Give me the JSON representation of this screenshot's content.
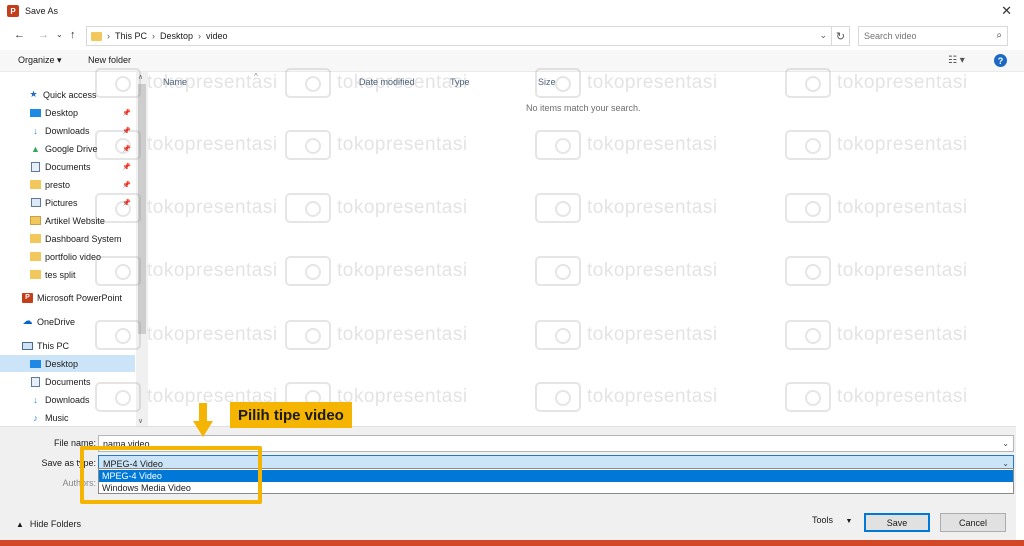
{
  "window": {
    "title": "Save As",
    "app_icon": "powerpoint-icon",
    "close_label": "✕"
  },
  "nav": {
    "back_label": "←",
    "forward_label": "→",
    "recent_label": "⌄",
    "up_label": "↑",
    "breadcrumbs": [
      "This PC",
      "Desktop",
      "video"
    ],
    "search_placeholder": "Search video"
  },
  "toolbar": {
    "organize_label": "Organize ▾",
    "new_folder_label": "New folder"
  },
  "sidebar": {
    "items": [
      {
        "label": "Quick access",
        "icon": "star-icon",
        "pinned": false
      },
      {
        "label": "Desktop",
        "icon": "desktop-icon",
        "pinned": true
      },
      {
        "label": "Downloads",
        "icon": "download-icon",
        "pinned": true
      },
      {
        "label": "Google Drive",
        "icon": "google-drive-icon",
        "pinned": true
      },
      {
        "label": "Documents",
        "icon": "documents-icon",
        "pinned": true
      },
      {
        "label": "presto",
        "icon": "folder-icon",
        "pinned": true
      },
      {
        "label": "Pictures",
        "icon": "pictures-icon",
        "pinned": true
      },
      {
        "label": "Artikel Website",
        "icon": "user-folder-icon",
        "pinned": false
      },
      {
        "label": "Dashboard System",
        "icon": "folder-icon",
        "pinned": false
      },
      {
        "label": "portfolio video",
        "icon": "folder-icon",
        "pinned": false
      },
      {
        "label": "tes split",
        "icon": "folder-icon",
        "pinned": false
      },
      {
        "label": "Microsoft PowerPoint",
        "icon": "powerpoint-icon",
        "pinned": false
      },
      {
        "label": "OneDrive",
        "icon": "onedrive-icon",
        "pinned": false
      },
      {
        "label": "This PC",
        "icon": "computer-icon",
        "pinned": false
      },
      {
        "label": "Desktop",
        "icon": "desktop-icon",
        "pinned": false
      },
      {
        "label": "Documents",
        "icon": "documents-icon",
        "pinned": false
      },
      {
        "label": "Downloads",
        "icon": "download-icon",
        "pinned": false
      },
      {
        "label": "Music",
        "icon": "music-icon",
        "pinned": false
      }
    ]
  },
  "filelist": {
    "columns": [
      "Name",
      "Date modified",
      "Type",
      "Size"
    ],
    "empty_message": "No items match your search."
  },
  "watermark": {
    "text": "tokopresentasi"
  },
  "form": {
    "file_name_label": "File name:",
    "file_name_value": "nama video",
    "save_as_type_label": "Save as type:",
    "save_as_type_value": "MPEG-4 Video",
    "authors_label": "Authors:",
    "type_options": [
      "MPEG-4 Video",
      "Windows Media Video"
    ]
  },
  "footer": {
    "hide_folders_label": "Hide Folders",
    "tools_label": "Tools",
    "save_label": "Save",
    "cancel_label": "Cancel"
  },
  "annotation": {
    "label": "Pilih tipe video",
    "color": "#f4b400"
  },
  "colors": {
    "selection": "#cce4f7",
    "accent": "#0078d7",
    "brand": "#c43e1c"
  }
}
